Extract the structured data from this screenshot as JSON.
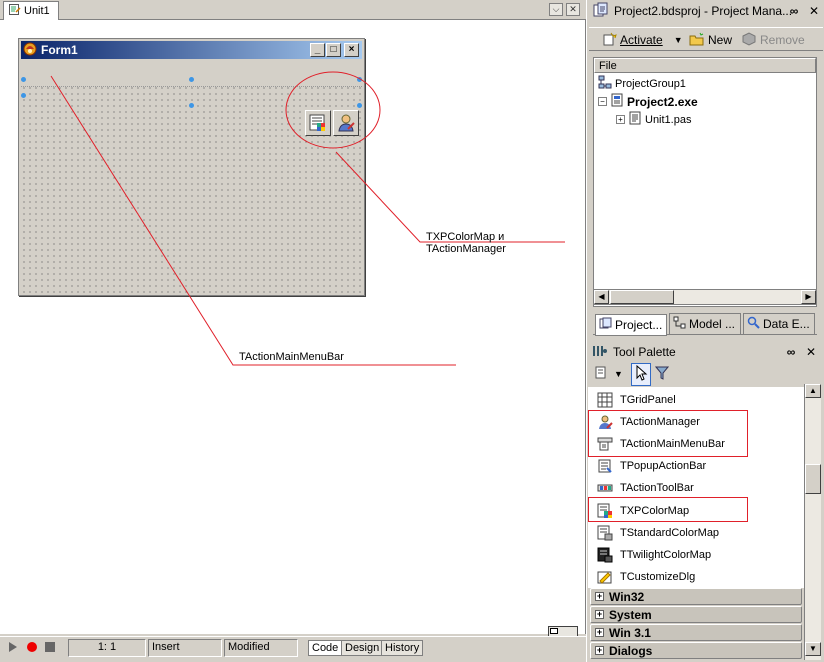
{
  "editor": {
    "tab_label": "Unit1",
    "form_caption": "Form1"
  },
  "annotations": {
    "colormap_manager": "TXPColorMap и TActionManager",
    "mainmenubar": "TActionMainMenuBar"
  },
  "status": {
    "position": "1:   1",
    "mode": "Insert",
    "state": "Modified",
    "tabs": [
      "Code",
      "Design",
      "History"
    ]
  },
  "project_manager": {
    "title": "Project2.bdsproj - Project Mana...",
    "toolbar": {
      "activate": "Activate",
      "new": "New",
      "remove": "Remove"
    },
    "column_header": "File",
    "tree": {
      "group": "ProjectGroup1",
      "project": "Project2.exe",
      "unit": "Unit1.pas"
    },
    "tabs": [
      "Project...",
      "Model ...",
      "Data E..."
    ]
  },
  "tool_palette": {
    "title": "Tool Palette",
    "items": [
      "TGridPanel",
      "TActionManager",
      "TActionMainMenuBar",
      "TPopupActionBar",
      "TActionToolBar",
      "TXPColorMap",
      "TStandardColorMap",
      "TTwilightColorMap",
      "TCustomizeDlg"
    ],
    "categories": [
      "Win32",
      "System",
      "Win 3.1",
      "Dialogs"
    ]
  },
  "colors": {
    "highlight_red": "#e0202a",
    "title_gradient_start": "#0a246a",
    "title_gradient_end": "#a6caf0"
  }
}
